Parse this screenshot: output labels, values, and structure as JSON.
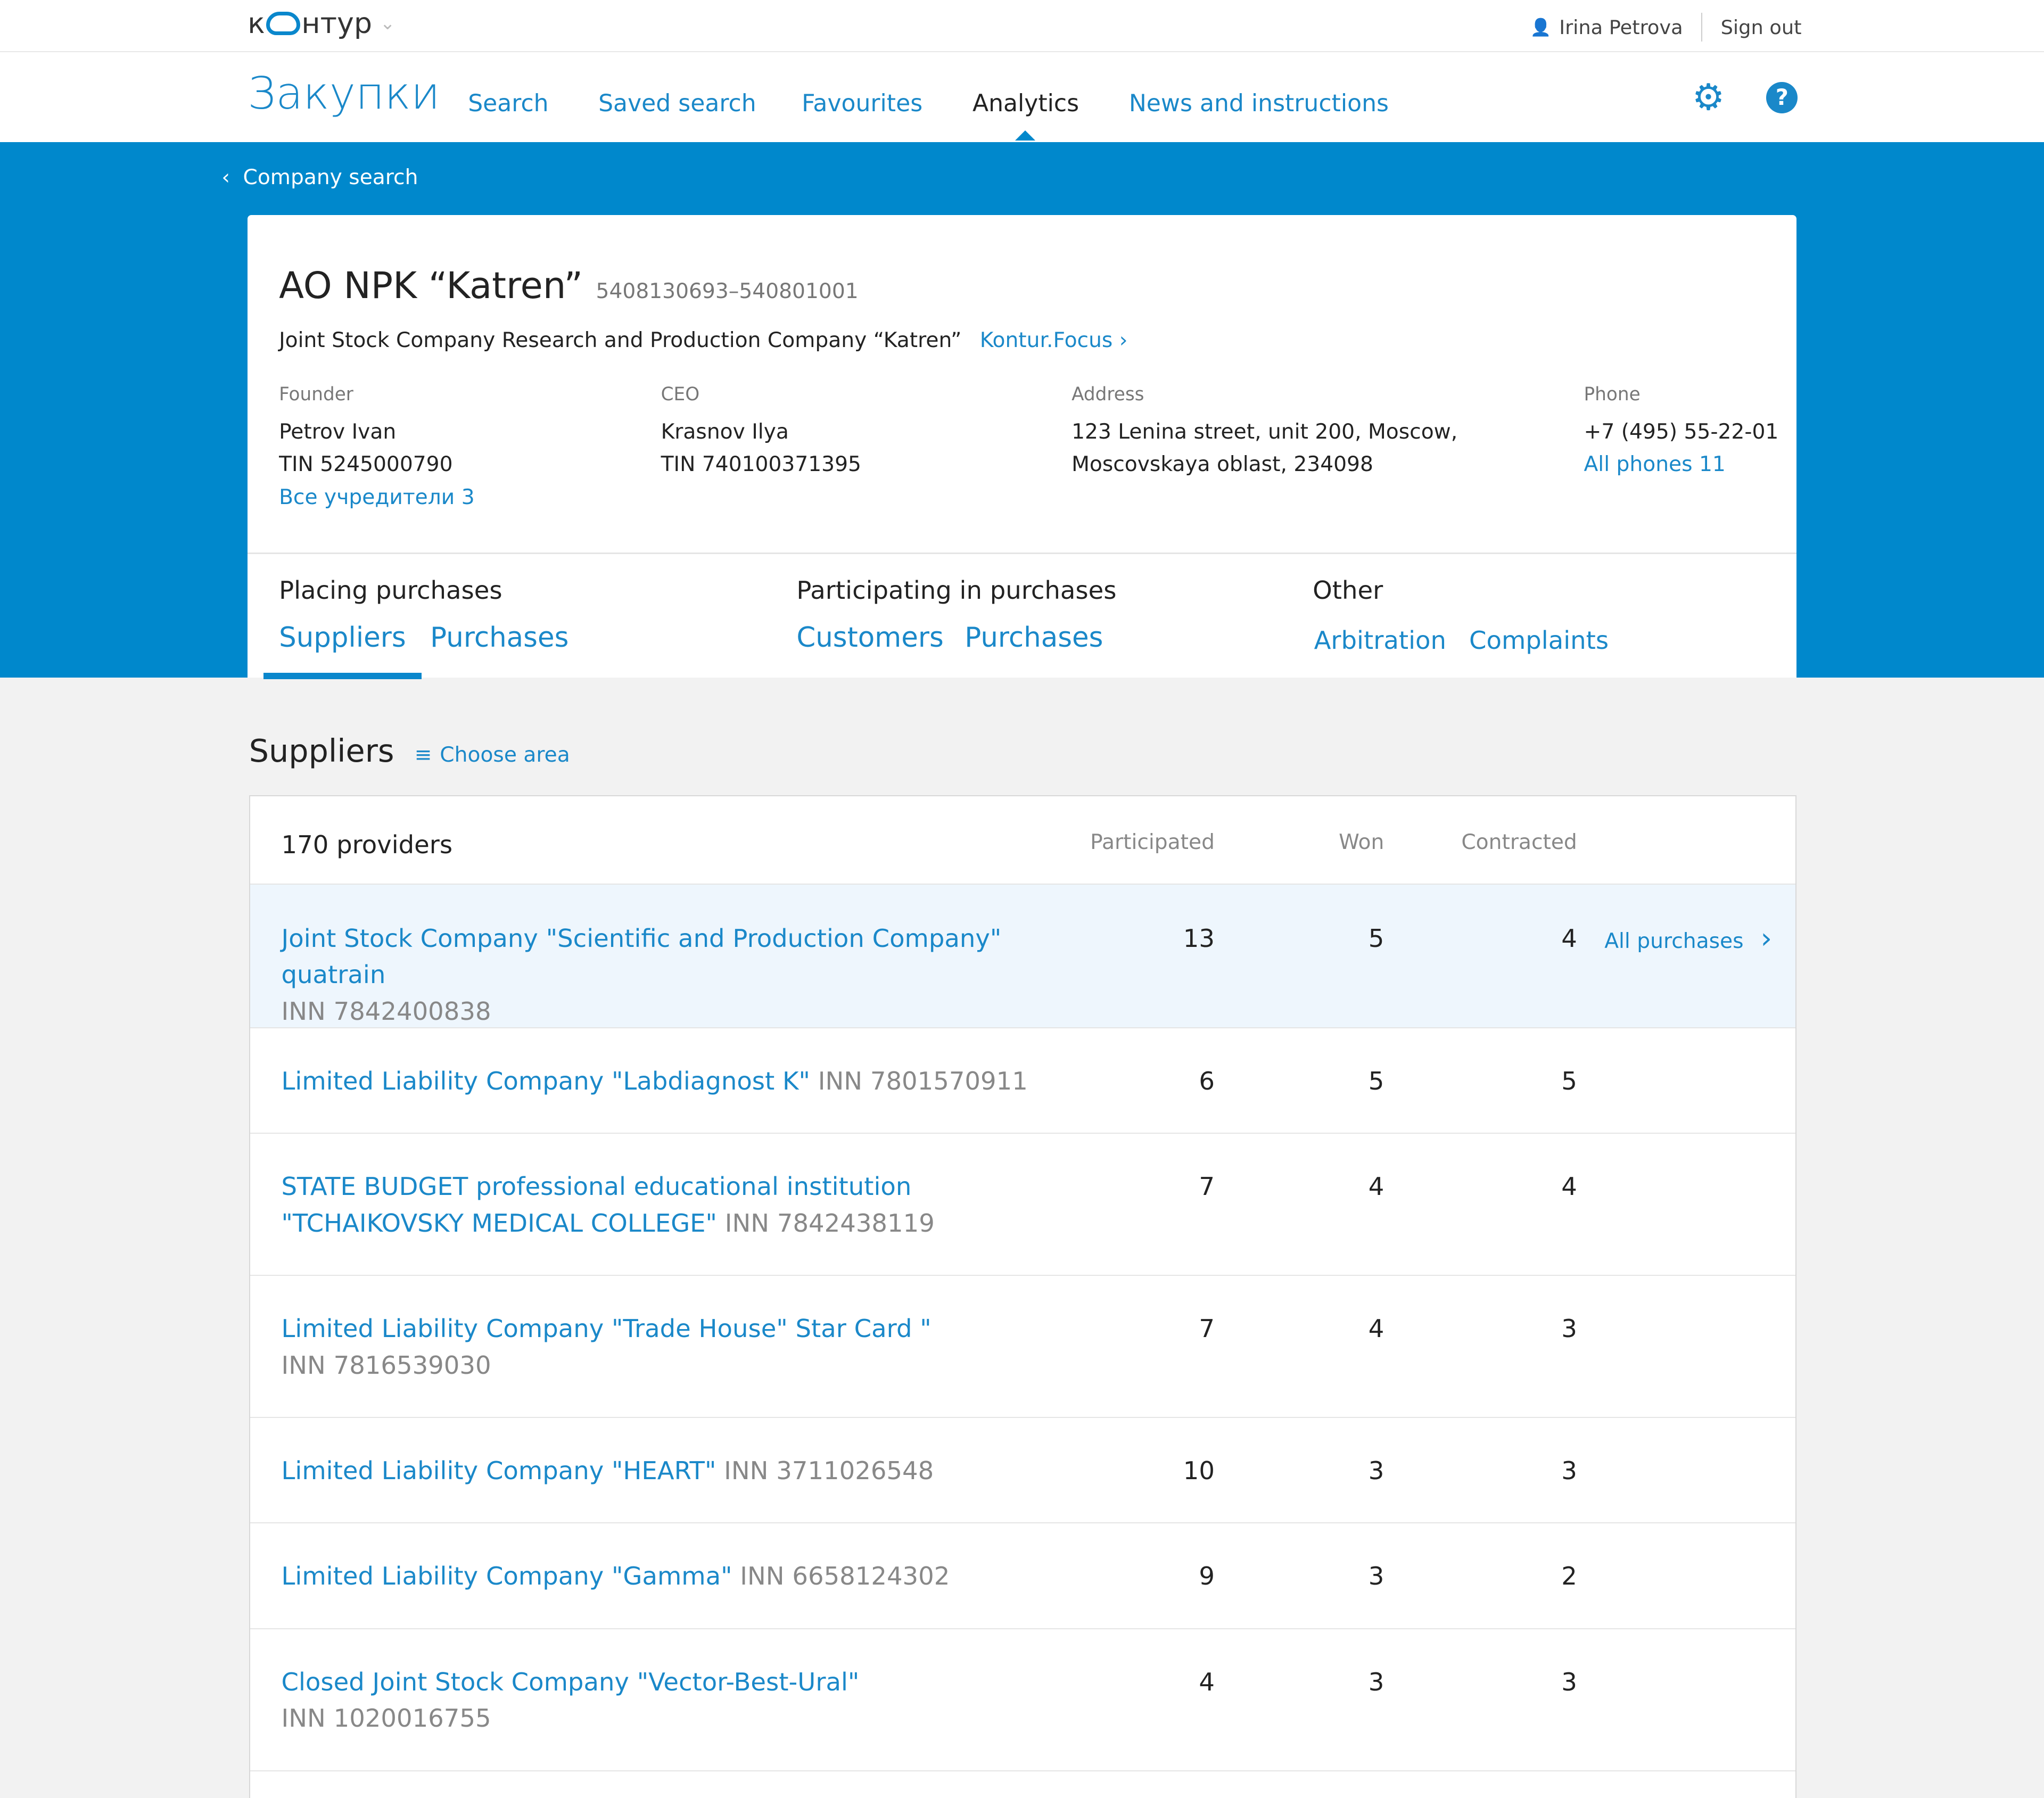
{
  "header": {
    "logo_text": "контур",
    "user": "Irina Petrova",
    "sign_out": "Sign out"
  },
  "nav": {
    "brand": "Закупки",
    "items": [
      "Search",
      "Saved search",
      "Favourites",
      "Analytics",
      "News and instructions"
    ],
    "active": "Analytics"
  },
  "breadcrumb": "Company search",
  "company": {
    "name": "AO NPK “Katren”",
    "inn": "5408130693–540801001",
    "full_name": "Joint Stock Company Research and Production Company “Katren”",
    "focus_link": "Kontur.Focus",
    "founder": {
      "label": "Founder",
      "name": "Petrov Ivan",
      "tin": "TIN 5245000790",
      "link": "Все учредители 3"
    },
    "ceo": {
      "label": "CEO",
      "name": "Krasnov Ilya",
      "tin": "TIN 740100371395"
    },
    "address": {
      "label": "Address",
      "line1": "123 Lenina street, unit 200, Moscow,",
      "line2": "Moscovskaya oblast, 234098"
    },
    "phone": {
      "label": "Phone",
      "value": "+7 (495) 55-22-01",
      "link": "All phones 11"
    }
  },
  "groups": [
    {
      "title": "Placing purchases",
      "tabs": [
        "Suppliers",
        "Purchases"
      ]
    },
    {
      "title": "Participating in purchases",
      "tabs": [
        "Customers",
        "Purchases"
      ]
    },
    {
      "title": "Other",
      "tabs": [
        "Arbitration",
        "Complaints"
      ]
    }
  ],
  "section": {
    "title": "Suppliers",
    "choose_area": "Choose area"
  },
  "table": {
    "count": "170 providers",
    "columns": [
      "Participated",
      "Won",
      "Contracted"
    ],
    "all_purchases": "All purchases",
    "rows": [
      {
        "name": "Joint Stock Company \"Scientific and Production Company\" quatrain",
        "inn": "INN 7842400838",
        "participated": "13",
        "won": "5",
        "contracted": "4"
      },
      {
        "name": "Limited Liability Company \"Labdiagnost K\"",
        "inn": "INN 7801570911",
        "participated": "6",
        "won": "5",
        "contracted": "5"
      },
      {
        "name": "STATE BUDGET professional educational institution \"TCHAIKOVSKY MEDICAL COLLEGE\"",
        "inn": "INN 7842438119",
        "participated": "7",
        "won": "4",
        "contracted": "4"
      },
      {
        "name": "Limited Liability Company \"Trade House\" Star Card \"",
        "inn": "INN 7816539030",
        "participated": "7",
        "won": "4",
        "contracted": "3"
      },
      {
        "name": "Limited Liability Company \"HEART\"",
        "inn": "INN 3711026548",
        "participated": "10",
        "won": "3",
        "contracted": "3"
      },
      {
        "name": "Limited Liability Company \"Gamma\"",
        "inn": "INN 6658124302",
        "participated": "9",
        "won": "3",
        "contracted": "2"
      },
      {
        "name": "Closed Joint Stock Company \"Vector-Best-Ural\"",
        "inn": "INN 1020016755",
        "participated": "4",
        "won": "3",
        "contracted": "3"
      }
    ]
  }
}
